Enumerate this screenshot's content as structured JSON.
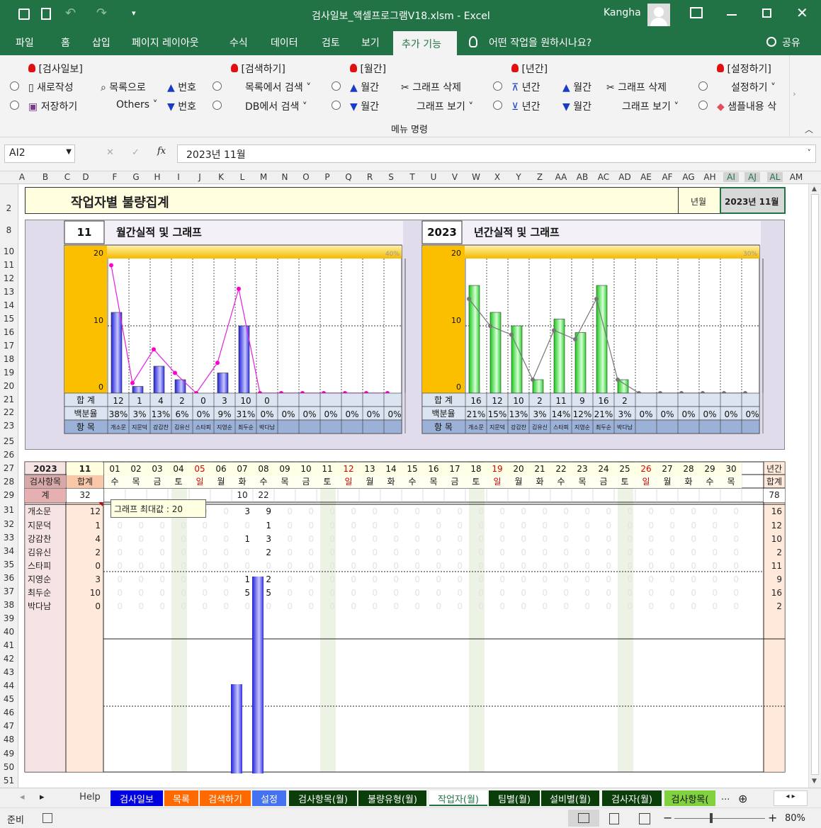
{
  "window": {
    "title": "검사일보_액셀프로그램V18.xlsm  -  Excel",
    "user": "Kangha"
  },
  "ribbon_tabs": [
    "파일",
    "홈",
    "삽입",
    "페이지 레이아웃",
    "수식",
    "데이터",
    "검토",
    "보기",
    "추가 기능"
  ],
  "tell_me": "어떤 작업을 원하시나요?",
  "share": "공유",
  "ribbon": {
    "groups": [
      "[검사일보]",
      "[검색하기]",
      "[월간]",
      "[년간]",
      "[설정하기]"
    ],
    "g1": [
      "새로작성",
      "저장하기",
      "목록으로",
      "Others",
      "번호",
      "번호"
    ],
    "g2": [
      "목록에서 검색",
      "DB에서 검색"
    ],
    "g3": [
      "월간",
      "월간",
      "그래프 삭제",
      "그래프 보기"
    ],
    "g4": [
      "년간",
      "년간",
      "월간",
      "월간",
      "그래프 삭제",
      "그래프 보기"
    ],
    "g5": [
      "설정하기",
      "샘플내용 삭"
    ],
    "footer": "메뉴 명령"
  },
  "formula": {
    "namebox": "AI2",
    "value": "2023년 11월"
  },
  "columns": [
    "A",
    "B",
    "C",
    "D",
    "F",
    "G",
    "H",
    "I",
    "J",
    "K",
    "L",
    "M",
    "N",
    "O",
    "P",
    "Q",
    "R",
    "S",
    "T",
    "U",
    "V",
    "W",
    "X",
    "Y",
    "Z",
    "AA",
    "AB",
    "AC",
    "AD",
    "AE",
    "AF",
    "AG",
    "AH",
    "AI",
    "AJ",
    "AL",
    "AM"
  ],
  "rows": [
    "2",
    "8",
    "10",
    "11",
    "12",
    "13",
    "14",
    "15",
    "16",
    "17",
    "18",
    "19",
    "20",
    "21",
    "22",
    "23",
    "25",
    "26",
    "27",
    "28",
    "29",
    "31",
    "32",
    "33",
    "34",
    "35",
    "36",
    "37",
    "38",
    "39",
    "40",
    "41",
    "42",
    "43",
    "44",
    "45",
    "46",
    "47",
    "48",
    "49",
    "50",
    "51"
  ],
  "report": {
    "title": "작업자별 불량집계",
    "ym_label": "년월",
    "ym_value": "2023년 11월"
  },
  "monthly": {
    "num": "11",
    "title": "월간실적 및 그래프",
    "ymax": "20",
    "ymid": "10",
    "ymin": "0",
    "pct_max": "40%",
    "totals": [
      "12",
      "1",
      "4",
      "2",
      "0",
      "3",
      "10",
      "0",
      "",
      "",
      "",
      "",
      "",
      ""
    ],
    "pcts": [
      "38%",
      "3%",
      "13%",
      "6%",
      "0%",
      "9%",
      "31%",
      "0%",
      "0%",
      "0%",
      "0%",
      "0%",
      "0%",
      "0%"
    ],
    "names": [
      "개소문",
      "지문덕",
      "강감찬",
      "김유신",
      "스타피",
      "지영순",
      "최두순",
      "박다남",
      "",
      "",
      "",
      "",
      "",
      ""
    ],
    "row_labels": [
      "합 계",
      "백분율",
      "항 목"
    ]
  },
  "yearly": {
    "num": "2023",
    "title": "년간실적 및 그래프",
    "ymax": "20",
    "ymid": "10",
    "ymin": "0",
    "pct_max": "30%",
    "totals": [
      "16",
      "12",
      "10",
      "2",
      "11",
      "9",
      "16",
      "2",
      "",
      "",
      "",
      "",
      "",
      ""
    ],
    "pcts": [
      "21%",
      "15%",
      "13%",
      "3%",
      "14%",
      "12%",
      "21%",
      "3%",
      "0%",
      "0%",
      "0%",
      "0%",
      "0%",
      "0%"
    ],
    "names": [
      "개소문",
      "지문덕",
      "강감찬",
      "김유신",
      "스타피",
      "지영순",
      "최두순",
      "박다남",
      "",
      "",
      "",
      "",
      "",
      ""
    ],
    "row_labels": [
      "합 계",
      "백분율",
      "항 목"
    ]
  },
  "chart_data": [
    {
      "type": "bar",
      "title": "월간실적 및 그래프",
      "categories": [
        "개소문",
        "지문덕",
        "강감찬",
        "김유신",
        "스타피",
        "지영순",
        "최두순",
        "박다남"
      ],
      "series": [
        {
          "values": [
            12,
            1,
            4,
            2,
            0,
            3,
            10,
            0
          ]
        }
      ],
      "line_pct": [
        38,
        3,
        13,
        6,
        0,
        9,
        31,
        0,
        0,
        0,
        0,
        0,
        0,
        0
      ],
      "ylim": [
        0,
        20
      ],
      "pct_max": 40
    },
    {
      "type": "bar",
      "title": "년간실적 및 그래프",
      "categories": [
        "개소문",
        "지문덕",
        "강감찬",
        "김유신",
        "스타피",
        "지영순",
        "최두순",
        "박다남"
      ],
      "series": [
        {
          "values": [
            16,
            12,
            10,
            2,
            11,
            9,
            16,
            2
          ]
        }
      ],
      "line_pct": [
        21,
        15,
        13,
        3,
        14,
        12,
        21,
        3,
        0,
        0,
        0,
        0,
        0,
        0
      ],
      "ylim": [
        0,
        20
      ],
      "pct_max": 30
    }
  ],
  "table": {
    "year": "2023",
    "month": "11",
    "item_label": "검사항목",
    "sum_label": "합계",
    "total_label": "계",
    "year_total_label": "년간",
    "year_sum_label": "합계",
    "grand_month": "32",
    "grand_year": "78",
    "days": [
      "01",
      "02",
      "03",
      "04",
      "05",
      "06",
      "07",
      "08",
      "09",
      "10",
      "11",
      "12",
      "13",
      "14",
      "15",
      "16",
      "17",
      "18",
      "19",
      "20",
      "21",
      "22",
      "23",
      "24",
      "25",
      "26",
      "27",
      "28",
      "29",
      "30"
    ],
    "weekdays": [
      "수",
      "목",
      "금",
      "토",
      "일",
      "월",
      "화",
      "수",
      "목",
      "금",
      "토",
      "일",
      "월",
      "화",
      "수",
      "목",
      "금",
      "토",
      "일",
      "월",
      "화",
      "수",
      "목",
      "금",
      "토",
      "일",
      "월",
      "화",
      "수",
      "목"
    ],
    "day_totals": {
      "7": "10",
      "8": "22"
    },
    "workers": [
      {
        "name": "개소문",
        "month": "12",
        "year": "16",
        "d7": "3",
        "d8": "9"
      },
      {
        "name": "지문덕",
        "month": "1",
        "year": "12",
        "d7": "",
        "d8": "1"
      },
      {
        "name": "강감찬",
        "month": "4",
        "year": "10",
        "d7": "1",
        "d8": "3"
      },
      {
        "name": "김유신",
        "month": "2",
        "year": "2",
        "d7": "",
        "d8": "2"
      },
      {
        "name": "스타피",
        "month": "0",
        "year": "11",
        "d7": "",
        "d8": ""
      },
      {
        "name": "지영순",
        "month": "3",
        "year": "9",
        "d7": "1",
        "d8": "2"
      },
      {
        "name": "최두순",
        "month": "10",
        "year": "16",
        "d7": "5",
        "d8": "5"
      },
      {
        "name": "박다남",
        "month": "0",
        "year": "2",
        "d7": "",
        "d8": ""
      }
    ],
    "comment": "그래프 최대값 : 20"
  },
  "sheet_tabs": [
    "Help",
    "검사일보",
    "목록",
    "검색하기",
    "설정",
    "검사항목(월)",
    "불량유형(월)",
    "작업자(월)",
    "팀별(월)",
    "설비별(월)",
    "검사자(월)",
    "검사항목(",
    "..."
  ],
  "status": {
    "ready": "준비",
    "zoom": "80%"
  }
}
